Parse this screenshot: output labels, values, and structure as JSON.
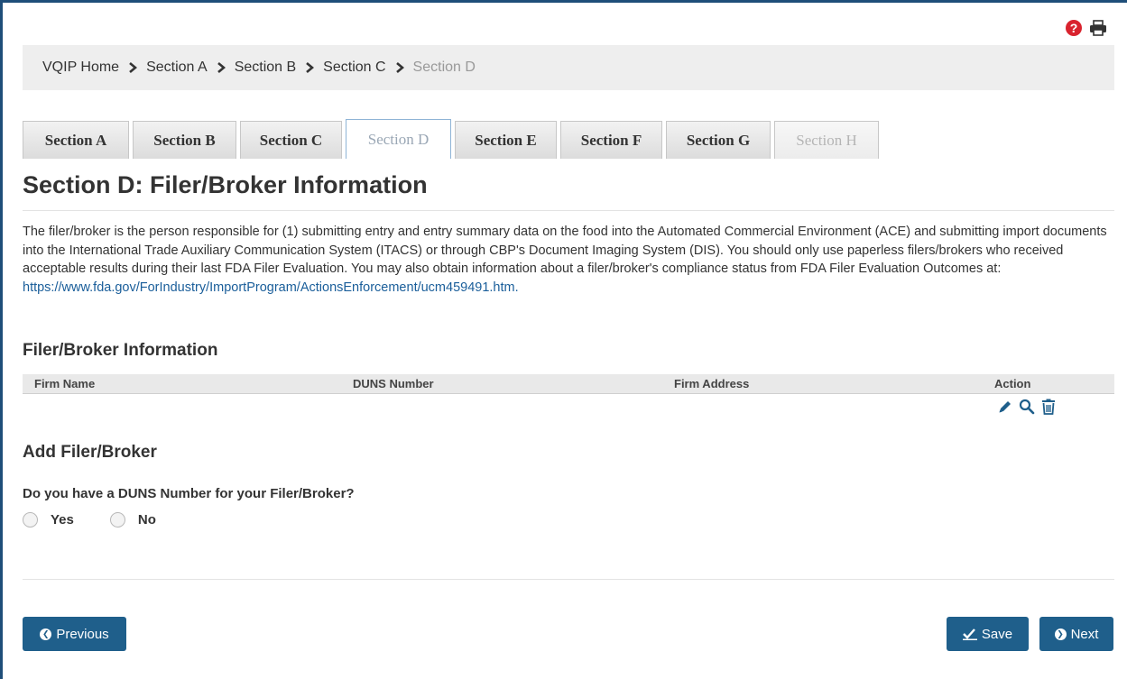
{
  "breadcrumb": {
    "items": [
      "VQIP Home",
      "Section A",
      "Section B",
      "Section C",
      "Section D"
    ]
  },
  "tabs": [
    {
      "label": "Section A",
      "state": "normal"
    },
    {
      "label": "Section B",
      "state": "normal"
    },
    {
      "label": "Section C",
      "state": "normal"
    },
    {
      "label": "Section D",
      "state": "active"
    },
    {
      "label": "Section E",
      "state": "normal"
    },
    {
      "label": "Section F",
      "state": "normal"
    },
    {
      "label": "Section G",
      "state": "normal"
    },
    {
      "label": "Section H",
      "state": "disabled"
    }
  ],
  "page": {
    "title": "Section D: Filer/Broker Information",
    "intro": "The filer/broker is the person responsible for (1) submitting entry and entry summary data on the food into the Automated Commercial Environment (ACE) and submitting import documents into the International Trade Auxiliary Communication System (ITACS) or through CBP's Document Imaging System (DIS). You should only use paperless filers/brokers who received acceptable results during their last FDA Filer Evaluation. You may also obtain information about a filer/broker's compliance status from FDA Filer Evaluation Outcomes at:",
    "intro_link": "https://www.fda.gov/ForIndustry/ImportProgram/ActionsEnforcement/ucm459491.htm."
  },
  "filer_table": {
    "heading": "Filer/Broker Information",
    "columns": [
      "Firm Name",
      "DUNS Number",
      "Firm Address",
      "Action"
    ],
    "action_icons": [
      "edit-icon",
      "search-icon",
      "trash-icon"
    ]
  },
  "add_section": {
    "heading": "Add Filer/Broker",
    "question": "Do you have a DUNS Number for your Filer/Broker?",
    "options": [
      "Yes",
      "No"
    ]
  },
  "footer": {
    "previous_label": "Previous",
    "save_label": "Save",
    "next_label": "Next"
  },
  "colors": {
    "accent": "#1f5f8b",
    "help": "#d9232e",
    "link": "#1a5e9a"
  }
}
